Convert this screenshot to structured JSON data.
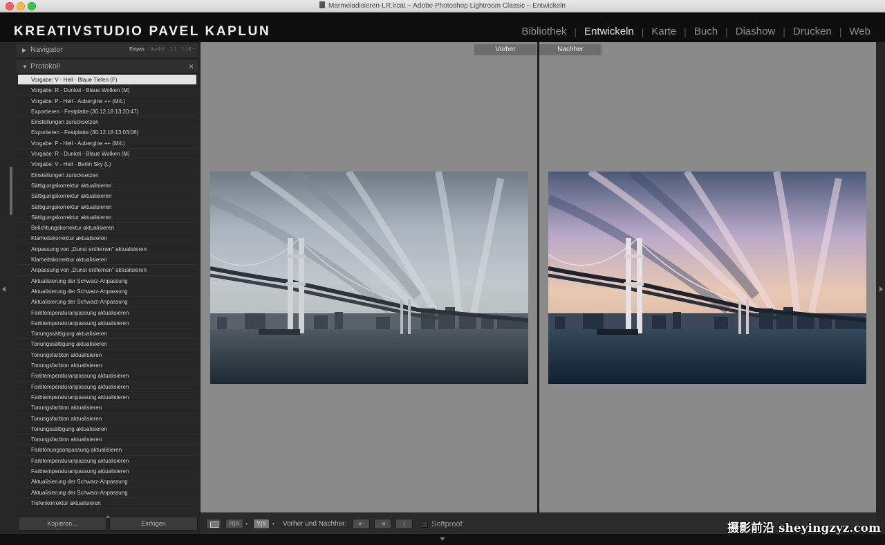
{
  "window": {
    "title": "Marmeladisieren-LR.lrcat – Adobe Photoshop Lightroom Classic – Entwickeln"
  },
  "identity_plate": "KREATIVSTUDIO PAVEL KAPLUN",
  "modules": [
    {
      "label": "Bibliothek",
      "active": false
    },
    {
      "label": "Entwickeln",
      "active": true
    },
    {
      "label": "Karte",
      "active": false
    },
    {
      "label": "Buch",
      "active": false
    },
    {
      "label": "Diashow",
      "active": false
    },
    {
      "label": "Drucken",
      "active": false
    },
    {
      "label": "Web",
      "active": false
    }
  ],
  "navigator": {
    "title": "Navigator",
    "zoom_options": [
      "Einpas.",
      "Ausful.",
      "1:1",
      "1:16 ÷"
    ],
    "zoom_active_index": 0
  },
  "history": {
    "title": "Protokoll",
    "close_glyph": "×",
    "selected_index": 0,
    "items": [
      "Vorgabe: V - Hell - Blaue Tiefen (F)",
      "Vorgabe: R - Dunkel - Blaue Wolken (M)",
      "Vorgabe: P - Hell - Aubergine ++ (M/L)",
      "Exportieren - Festplatte (30.12.18 13:20:47)",
      "Einstellungen zurücksetzen",
      "Exportieren - Festplatte (30.12.18 13:03:06)",
      "Vorgabe: P - Hell - Aubergine ++ (M/L)",
      "Vorgabe: R - Dunkel - Blaue Wolken (M)",
      "Vorgabe: V - Hell - Berlin Sky (L)",
      "Einstellungen zurücksetzen",
      "Sättigungskorrektur aktualisieren",
      "Sättigungskorrektur aktualisieren",
      "Sättigungskorrektur aktualisieren",
      "Sättigungskorrektur aktualisieren",
      "Belichtungskorrektur aktualisieren",
      "Klarheitskorrektur aktualisieren",
      "Anpassung von „Dunst entfernen\" aktualisieren",
      "Klarheitskorrektur aktualisieren",
      "Anpassung von „Dunst entfernen\" aktualisieren",
      "Aktualisierung der Schwarz-Anpassung",
      "Aktualisierung der Schwarz-Anpassung",
      "Aktualisierung der Schwarz-Anpassung",
      "Farbtemperaturanpassung aktualisieren",
      "Farbtemperaturanpassung aktualisieren",
      "Tonungssättigung aktualisieren",
      "Tonungssättigung aktualisieren",
      "Tonungsfarbton aktualisieren",
      "Tonungsfarbton aktualisieren",
      "Farbtemperaturanpassung aktualisieren",
      "Farbtemperaturanpassung aktualisieren",
      "Farbtemperaturanpassung aktualisieren",
      "Tonungsfarbton aktualisieren",
      "Tonungsfarbton aktualisieren",
      "Tonungssättigung aktualisieren",
      "Tonungsfarbton aktualisieren",
      "Farbtönungsanpassung aktualisieren",
      "Farbtemperaturanpassung aktualisieren",
      "Farbtemperaturanpassung aktualisieren",
      "Aktualisierung der Schwarz-Anpassung",
      "Aktualisierung der Schwarz-Anpassung",
      "Tiefenkorrektur aktualisieren"
    ]
  },
  "left_buttons": {
    "copy": "Kopieren...",
    "paste": "Einfügen"
  },
  "compare": {
    "before_label": "Vorher",
    "after_label": "Nachher"
  },
  "toolbar": {
    "ra_label": "R|A",
    "yy_label": "Y|Y",
    "dropdown_glyph": "▾",
    "before_after_label": "Vorher und Nachher:",
    "swap_left_label": "⇤",
    "swap_right_label": "⇥",
    "swap_vert_label": "↕",
    "softproof_label": "Softproof",
    "softproof_checked": false
  },
  "watermark": "摄影前沿 sheyingzyz.com",
  "colors": {
    "background_canvas": "#8a8a8a",
    "panel_bg": "#262626",
    "selected_row_bg": "#e3e3e3",
    "active_module": "#e6e6e6",
    "inactive_module": "#8f8f8f"
  },
  "icons": {
    "close": "close-icon",
    "minimize": "minimize-icon",
    "maximize": "maximize-icon",
    "document": "document-icon",
    "panel_expand": "triangle-right-icon",
    "panel_collapse": "triangle-down-icon",
    "loupe": "loupe-view-icon"
  }
}
